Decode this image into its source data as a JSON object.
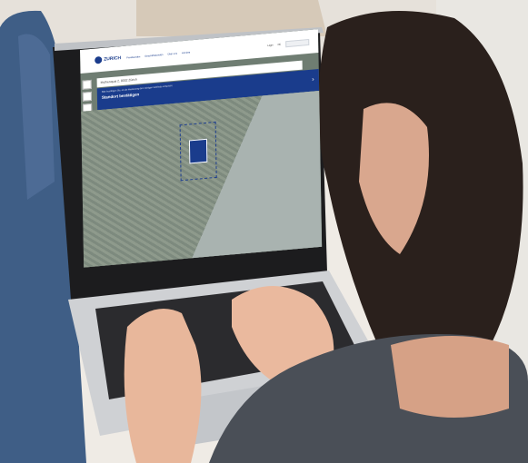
{
  "screen": {
    "brand": "ZURICH",
    "nav": [
      "Privatkunden",
      "Geschäftskunden",
      "Über uns",
      "Karriere"
    ],
    "top_right": [
      "Login",
      "DE"
    ],
    "address_value": "Mythenquai 2, 8002 Zürich",
    "confirm_note": "Bitte bestätigen Sie, ob die Markierung dem richtigen Gebäude entspricht.",
    "confirm_title": "Standort bestätigen"
  },
  "colors": {
    "brand_blue": "#1a3c8c"
  }
}
